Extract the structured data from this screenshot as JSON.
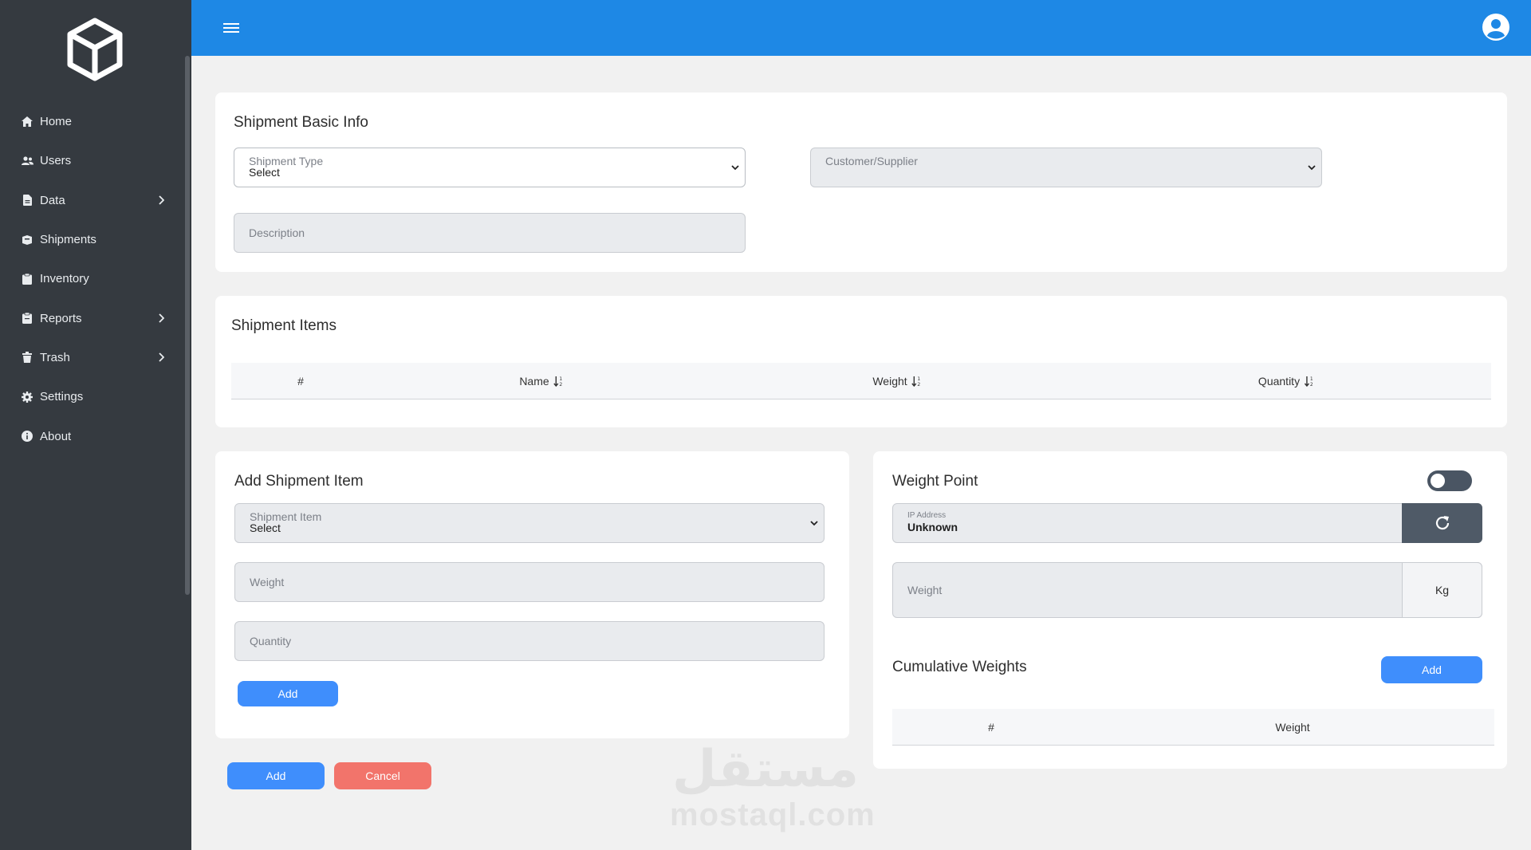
{
  "nav": {
    "items": [
      {
        "label": "Home",
        "icon": "home-icon",
        "chevron": false
      },
      {
        "label": "Users",
        "icon": "users-icon",
        "chevron": false
      },
      {
        "label": "Data",
        "icon": "file-icon",
        "chevron": true
      },
      {
        "label": "Shipments",
        "icon": "box-icon",
        "chevron": false
      },
      {
        "label": "Inventory",
        "icon": "clipboard-icon",
        "chevron": false
      },
      {
        "label": "Reports",
        "icon": "report-icon",
        "chevron": true
      },
      {
        "label": "Trash",
        "icon": "trash-icon",
        "chevron": true
      },
      {
        "label": "Settings",
        "icon": "gear-icon",
        "chevron": false
      },
      {
        "label": "About",
        "icon": "info-icon",
        "chevron": false
      }
    ]
  },
  "colors": {
    "sidebar": "#353a40",
    "topbar": "#1e88e5",
    "primary_button": "#3f8efc",
    "cancel_button": "#f2746b",
    "toggle_off": "#4a5563"
  },
  "basic_info": {
    "title": "Shipment Basic Info",
    "shipment_type_label": "Shipment Type",
    "shipment_type_value": "Select",
    "customer_label": "Customer/Supplier",
    "description_placeholder": "Description"
  },
  "items": {
    "title": "Shipment Items",
    "columns": [
      "#",
      "Name",
      "Weight",
      "Quantity"
    ]
  },
  "add_item": {
    "title": "Add Shipment Item",
    "item_label": "Shipment Item",
    "item_value": "Select",
    "weight_placeholder": "Weight",
    "quantity_placeholder": "Quantity",
    "add_label": "Add"
  },
  "weight_point": {
    "title": "Weight Point",
    "toggle_on": false,
    "ip_label": "IP Address",
    "ip_value": "Unknown",
    "weight_placeholder": "Weight",
    "unit": "Kg"
  },
  "cumulative": {
    "title": "Cumulative Weights",
    "add_label": "Add",
    "columns": [
      "#",
      "Weight"
    ]
  },
  "footer": {
    "add_label": "Add",
    "cancel_label": "Cancel"
  },
  "watermark": {
    "arabic": "مستقل",
    "latin": "mostaql.com"
  }
}
